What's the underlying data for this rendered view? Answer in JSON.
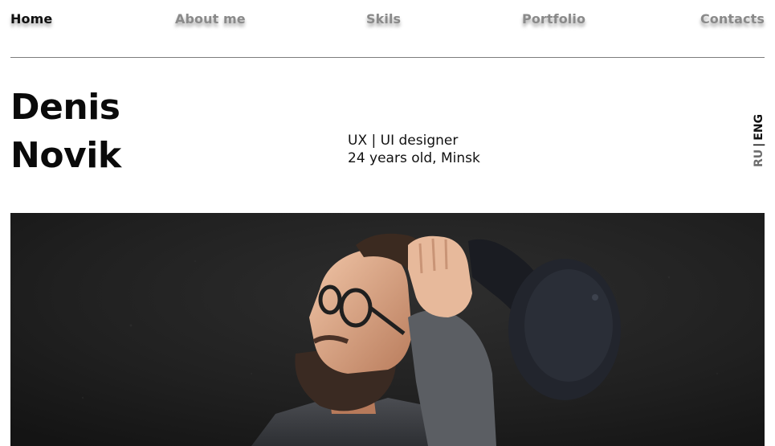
{
  "nav": {
    "items": [
      {
        "label": "Home",
        "active": true
      },
      {
        "label": "About me",
        "active": false
      },
      {
        "label": "Skils",
        "active": false
      },
      {
        "label": "Portfolio",
        "active": false
      },
      {
        "label": "Contacts",
        "active": false
      }
    ]
  },
  "hero": {
    "first_name": "Denis",
    "last_name": "Novik",
    "role": "UX | UI designer",
    "details": "24 years old, Minsk"
  },
  "lang": {
    "ru": "RU",
    "separator": "|",
    "eng": "ENG",
    "active": "ENG"
  },
  "photo": {
    "subject": "man-with-glasses-holding-cap-photo"
  },
  "colors": {
    "nav_inactive": "#8a8a8a",
    "nav_active": "#111111",
    "photo_background": "#1c1c1c"
  }
}
